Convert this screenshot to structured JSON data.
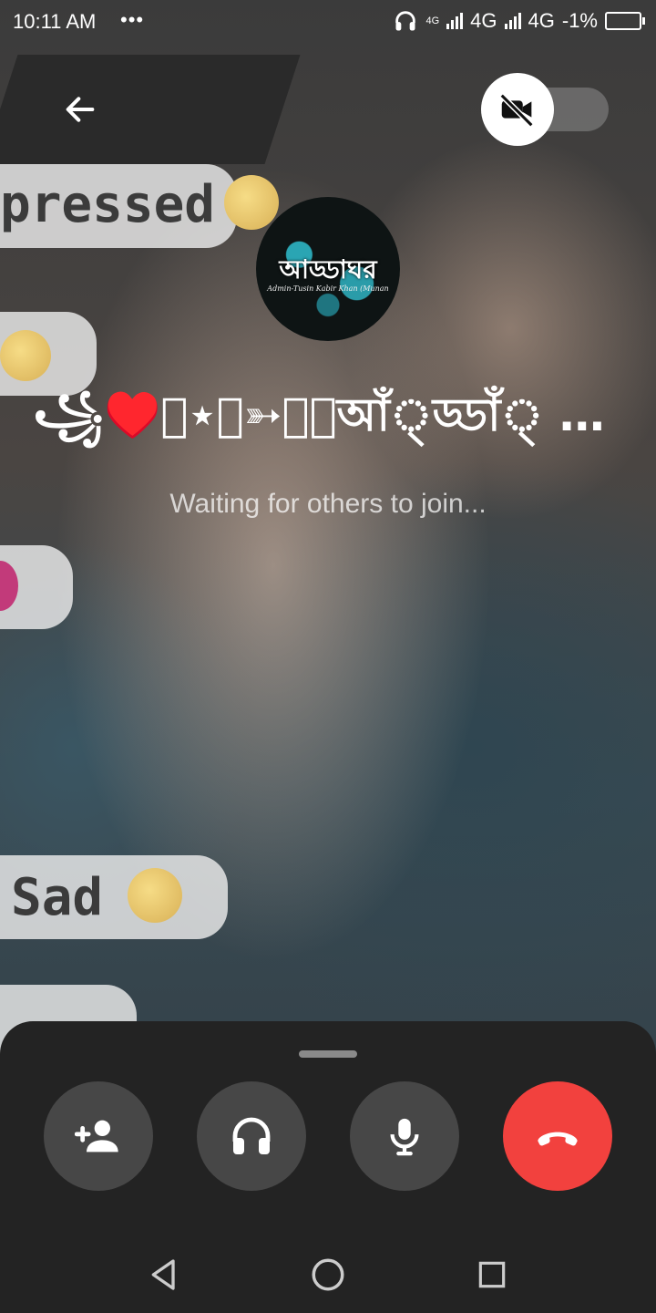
{
  "status_bar": {
    "time": "10:11 AM",
    "dots": "•••",
    "network_1": "4G",
    "network_2": "4G",
    "battery": "-1%",
    "small_4g": "4G"
  },
  "background": {
    "bubble_1_text": "pressed",
    "bubble_2_text": "Sad"
  },
  "avatar": {
    "logo_text": "আড্ডাঘর",
    "logo_sub": "Admin-Tusin Kabir Khan (Munan"
  },
  "call": {
    "title": "꧁⁠♥️⁠⁠⁠⃝⋆⃟➳⃝⦁আঁ্ড্ডাঁ্ ঘঁ্রঁ্♥️⁠⃝⃟➳⃝…",
    "status": "Waiting for others to join..."
  },
  "colors": {
    "end_call": "#f2413e",
    "control_bg": "#474747",
    "sheet_bg": "#232323"
  },
  "icons": {
    "back": "arrow-left-icon",
    "video": "video-off-icon",
    "add_person": "person-add-icon",
    "audio": "headphones-icon",
    "mic": "microphone-icon",
    "end": "call-end-icon",
    "nav_back": "triangle-back-icon",
    "nav_home": "circle-home-icon",
    "nav_recents": "square-recents-icon"
  }
}
